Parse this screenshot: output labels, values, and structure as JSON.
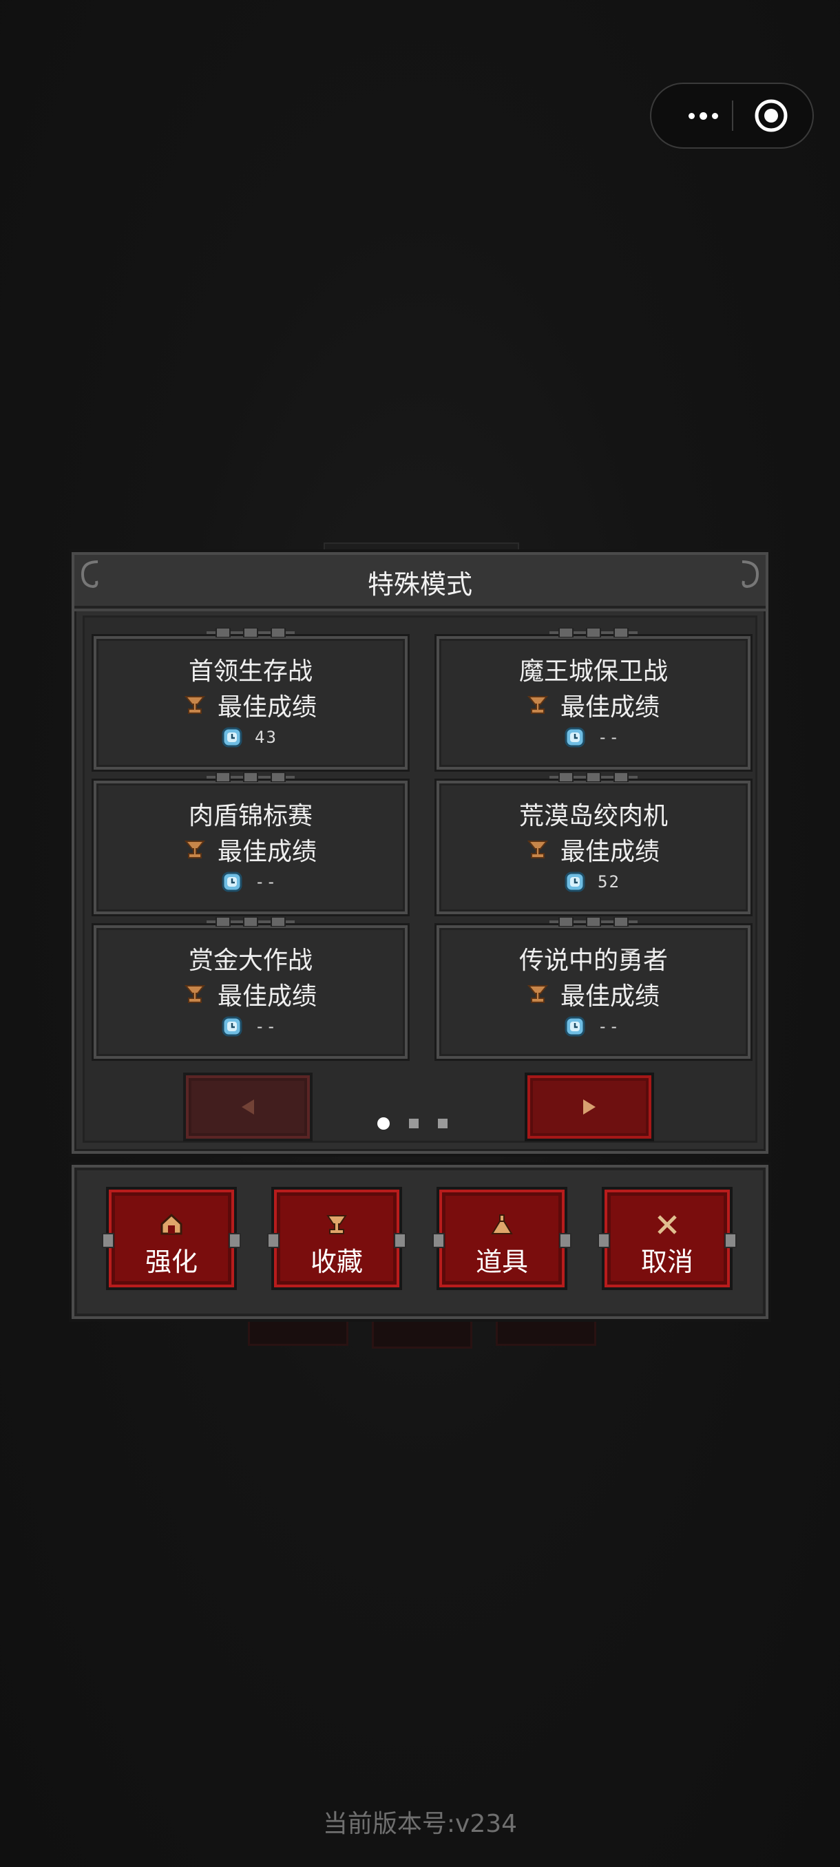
{
  "capsule": {
    "menu_icon": "more-dots-icon",
    "close_icon": "target-circle-icon"
  },
  "dialog": {
    "title": "特殊模式",
    "modes": [
      {
        "name": "首领生存战",
        "best_label": "最佳成绩",
        "score": "43"
      },
      {
        "name": "魔王城保卫战",
        "best_label": "最佳成绩",
        "score": "--"
      },
      {
        "name": "肉盾锦标赛",
        "best_label": "最佳成绩",
        "score": "--"
      },
      {
        "name": "荒漠岛绞肉机",
        "best_label": "最佳成绩",
        "score": "52"
      },
      {
        "name": "赏金大作战",
        "best_label": "最佳成绩",
        "score": "--"
      },
      {
        "name": "传说中的勇者",
        "best_label": "最佳成绩",
        "score": "--"
      }
    ],
    "pagination": {
      "current_page": 1,
      "total_pages": 3
    }
  },
  "actions": [
    {
      "label": "强化",
      "icon": "upgrade-icon"
    },
    {
      "label": "收藏",
      "icon": "trophy-icon"
    },
    {
      "label": "道具",
      "icon": "potion-icon"
    },
    {
      "label": "取消",
      "icon": "cross-swords-icon"
    }
  ],
  "footer": {
    "version": "当前版本号:v234"
  },
  "colors": {
    "background": "#111111",
    "panel": "#2f2f2f",
    "button_red": "#7a0d0d",
    "trophy": "#c8864a",
    "clock": "#5aaed8"
  }
}
